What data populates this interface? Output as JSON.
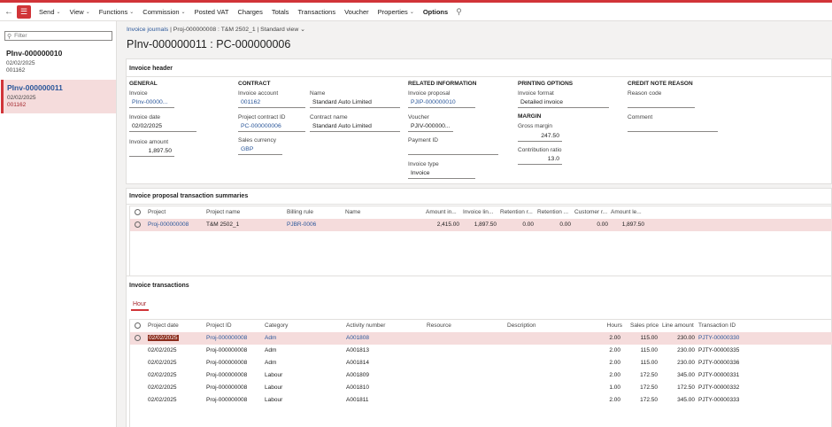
{
  "toolbar": {
    "items": [
      {
        "label": "Send",
        "dropdown": true
      },
      {
        "label": "View",
        "dropdown": true
      },
      {
        "label": "Functions",
        "dropdown": true
      },
      {
        "label": "Commission",
        "dropdown": true
      },
      {
        "label": "Posted VAT",
        "dropdown": false
      },
      {
        "label": "Charges",
        "dropdown": false
      },
      {
        "label": "Totals",
        "dropdown": false
      },
      {
        "label": "Transactions",
        "dropdown": false
      },
      {
        "label": "Voucher",
        "dropdown": false
      },
      {
        "label": "Properties",
        "dropdown": true
      },
      {
        "label": "Options",
        "dropdown": false
      }
    ]
  },
  "sidebar": {
    "filter_placeholder": "Filter",
    "records": [
      {
        "title": "PInv-000000010",
        "date": "02/02/2025",
        "account": "001162"
      },
      {
        "title": "PInv-000000011",
        "date": "02/02/2025",
        "account": "001162"
      }
    ]
  },
  "breadcrumb": {
    "link": "Invoice journals",
    "path": "Proj-000000008 : T&M 2502_1",
    "view": "Standard view"
  },
  "page_title": "PInv-000000011 : PC-000000006",
  "invoice_header": {
    "title": "Invoice header",
    "general": {
      "heading": "GENERAL",
      "invoice_label": "Invoice",
      "invoice_value": "PInv-00000...",
      "date_label": "Invoice date",
      "date_value": "02/02/2025",
      "amount_label": "Invoice amount",
      "amount_value": "1,897.50"
    },
    "contract": {
      "heading": "CONTRACT",
      "account_label": "Invoice account",
      "account_value": "001162",
      "name_label": "Name",
      "name_value": "Standard Auto Limited",
      "contract_id_label": "Project contract ID",
      "contract_id_value": "PC-000000006",
      "contract_name_label": "Contract name",
      "contract_name_value": "Standard Auto Limited",
      "currency_label": "Sales currency",
      "currency_value": "GBP"
    },
    "related": {
      "heading": "RELATED INFORMATION",
      "proposal_label": "Invoice proposal",
      "proposal_value": "PJIP-000000010",
      "voucher_label": "Voucher",
      "voucher_value": "PJIV-000000...",
      "payment_label": "Payment ID",
      "payment_value": "",
      "type_label": "Invoice type",
      "type_value": "Invoice"
    },
    "printing": {
      "heading": "PRINTING OPTIONS",
      "format_label": "Invoice format",
      "format_value": "Detailed invoice",
      "margin_heading": "MARGIN",
      "gross_label": "Gross margin",
      "gross_value": "247.50",
      "ratio_label": "Contribution ratio",
      "ratio_value": "13.0"
    },
    "credit": {
      "heading": "CREDIT NOTE REASON",
      "reason_label": "Reason code",
      "reason_value": "",
      "comment_label": "Comment",
      "comment_value": ""
    }
  },
  "summaries": {
    "title": "Invoice proposal transaction summaries",
    "columns": [
      "Project",
      "Project name",
      "Billing rule",
      "Name",
      "Amount in...",
      "Invoice lin...",
      "Retention r...",
      "Retention ...",
      "Customer r...",
      "Amount le..."
    ],
    "rows": [
      {
        "project": "Proj-000000008",
        "project_name": "T&M 2502_1",
        "billing_rule": "PJBR-0006",
        "name": "",
        "amount_in": "2,415.00",
        "invoice_line": "1,897.50",
        "retention_r": "0.00",
        "retention": "0.00",
        "customer_r": "0.00",
        "amount_left": "1,897.50"
      }
    ]
  },
  "transactions": {
    "title": "Invoice transactions",
    "tab": "Hour",
    "columns": [
      "Project date",
      "Project ID",
      "Category",
      "Activity number",
      "Resource",
      "Description",
      "Hours",
      "Sales price",
      "Line amount",
      "Transaction ID"
    ],
    "rows": [
      {
        "date": "02/02/2025",
        "project_id": "Proj-000000008",
        "category": "Adm",
        "activity": "A001808",
        "resource": "",
        "description": "",
        "hours": "2.00",
        "price": "115.00",
        "amount": "230.00",
        "txn": "PJTY-00000330"
      },
      {
        "date": "02/02/2025",
        "project_id": "Proj-000000008",
        "category": "Adm",
        "activity": "A001813",
        "resource": "",
        "description": "",
        "hours": "2.00",
        "price": "115.00",
        "amount": "230.00",
        "txn": "PJTY-00000335"
      },
      {
        "date": "02/02/2025",
        "project_id": "Proj-000000008",
        "category": "Adm",
        "activity": "A001814",
        "resource": "",
        "description": "",
        "hours": "2.00",
        "price": "115.00",
        "amount": "230.00",
        "txn": "PJTY-00000336"
      },
      {
        "date": "02/02/2025",
        "project_id": "Proj-000000008",
        "category": "Labour",
        "activity": "A001809",
        "resource": "",
        "description": "",
        "hours": "2.00",
        "price": "172.50",
        "amount": "345.00",
        "txn": "PJTY-00000331"
      },
      {
        "date": "02/02/2025",
        "project_id": "Proj-000000008",
        "category": "Labour",
        "activity": "A001810",
        "resource": "",
        "description": "",
        "hours": "1.00",
        "price": "172.50",
        "amount": "172.50",
        "txn": "PJTY-00000332"
      },
      {
        "date": "02/02/2025",
        "project_id": "Proj-000000008",
        "category": "Labour",
        "activity": "A001811",
        "resource": "",
        "description": "",
        "hours": "2.00",
        "price": "172.50",
        "amount": "345.00",
        "txn": "PJTY-00000333"
      }
    ]
  }
}
